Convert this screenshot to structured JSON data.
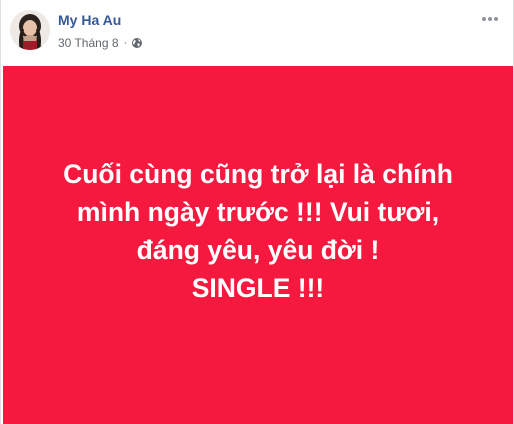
{
  "post": {
    "author": "My Ha Au",
    "date": "30 Tháng 8",
    "separator": "·",
    "privacy_icon": "globe-icon",
    "more_icon": "more-horizontal-icon",
    "avatar": "profile-photo"
  },
  "status": {
    "background_color": "#f5193f",
    "text_color": "#ffffff",
    "lines": [
      "Cuối cùng cũng trở lại là chính",
      "mình ngày trước !!! Vui tươi,",
      "đáng yêu, yêu đời !",
      "SINGLE !!!"
    ]
  }
}
